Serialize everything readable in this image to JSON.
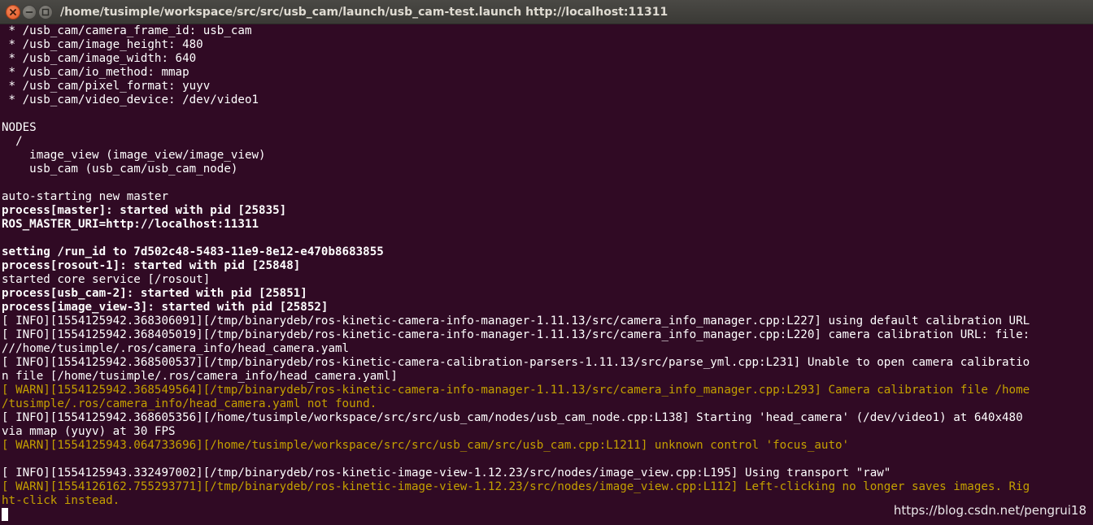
{
  "window": {
    "title": "/home/tusimple/workspace/src/src/usb_cam/launch/usb_cam-test.launch http://localhost:11311",
    "buttons": [
      "close",
      "minimize",
      "maximize"
    ]
  },
  "terminal": {
    "background": "#300a24",
    "warn_color": "#c4a000",
    "lines": [
      {
        "text": " * /usb_cam/camera_frame_id: usb_cam",
        "style": "normal"
      },
      {
        "text": " * /usb_cam/image_height: 480",
        "style": "normal"
      },
      {
        "text": " * /usb_cam/image_width: 640",
        "style": "normal"
      },
      {
        "text": " * /usb_cam/io_method: mmap",
        "style": "normal"
      },
      {
        "text": " * /usb_cam/pixel_format: yuyv",
        "style": "normal"
      },
      {
        "text": " * /usb_cam/video_device: /dev/video1",
        "style": "normal"
      },
      {
        "text": "",
        "style": "normal"
      },
      {
        "text": "NODES",
        "style": "normal"
      },
      {
        "text": "  /",
        "style": "normal"
      },
      {
        "text": "    image_view (image_view/image_view)",
        "style": "normal"
      },
      {
        "text": "    usb_cam (usb_cam/usb_cam_node)",
        "style": "normal"
      },
      {
        "text": "",
        "style": "normal"
      },
      {
        "text": "auto-starting new master",
        "style": "normal"
      },
      {
        "text": "process[master]: started with pid [25835]",
        "style": "bold"
      },
      {
        "text": "ROS_MASTER_URI=http://localhost:11311",
        "style": "bold"
      },
      {
        "text": "",
        "style": "normal"
      },
      {
        "text": "setting /run_id to 7d502c48-5483-11e9-8e12-e470b8683855",
        "style": "bold"
      },
      {
        "text": "process[rosout-1]: started with pid [25848]",
        "style": "bold"
      },
      {
        "text": "started core service [/rosout]",
        "style": "normal"
      },
      {
        "text": "process[usb_cam-2]: started with pid [25851]",
        "style": "bold"
      },
      {
        "text": "process[image_view-3]: started with pid [25852]",
        "style": "bold"
      },
      {
        "text": "[ INFO][1554125942.368306091][/tmp/binarydeb/ros-kinetic-camera-info-manager-1.11.13/src/camera_info_manager.cpp:L227] using default calibration URL",
        "style": "normal"
      },
      {
        "text": "[ INFO][1554125942.368405019][/tmp/binarydeb/ros-kinetic-camera-info-manager-1.11.13/src/camera_info_manager.cpp:L220] camera calibration URL: file:",
        "style": "normal"
      },
      {
        "text": "///home/tusimple/.ros/camera_info/head_camera.yaml",
        "style": "normal"
      },
      {
        "text": "[ INFO][1554125942.368500537][/tmp/binarydeb/ros-kinetic-camera-calibration-parsers-1.11.13/src/parse_yml.cpp:L231] Unable to open camera calibratio",
        "style": "normal"
      },
      {
        "text": "n file [/home/tusimple/.ros/camera_info/head_camera.yaml]",
        "style": "normal"
      },
      {
        "text": "[ WARN][1554125942.368549564][/tmp/binarydeb/ros-kinetic-camera-info-manager-1.11.13/src/camera_info_manager.cpp:L293] Camera calibration file /home",
        "style": "warn"
      },
      {
        "text": "/tusimple/.ros/camera_info/head_camera.yaml not found.",
        "style": "warn"
      },
      {
        "text": "[ INFO][1554125942.368605356][/home/tusimple/workspace/src/src/usb_cam/nodes/usb_cam_node.cpp:L138] Starting 'head_camera' (/dev/video1) at 640x480",
        "style": "normal"
      },
      {
        "text": "via mmap (yuyv) at 30 FPS",
        "style": "normal"
      },
      {
        "text": "[ WARN][1554125943.064733696][/home/tusimple/workspace/src/src/usb_cam/src/usb_cam.cpp:L1211] unknown control 'focus_auto'",
        "style": "warn"
      },
      {
        "text": "",
        "style": "normal"
      },
      {
        "text": "[ INFO][1554125943.332497002][/tmp/binarydeb/ros-kinetic-image-view-1.12.23/src/nodes/image_view.cpp:L195] Using transport \"raw\"",
        "style": "normal"
      },
      {
        "text": "[ WARN][1554126162.755293771][/tmp/binarydeb/ros-kinetic-image-view-1.12.23/src/nodes/image_view.cpp:L112] Left-clicking no longer saves images. Rig",
        "style": "warn"
      },
      {
        "text": "ht-click instead.",
        "style": "warn"
      }
    ]
  },
  "watermark": "https://blog.csdn.net/pengrui18"
}
